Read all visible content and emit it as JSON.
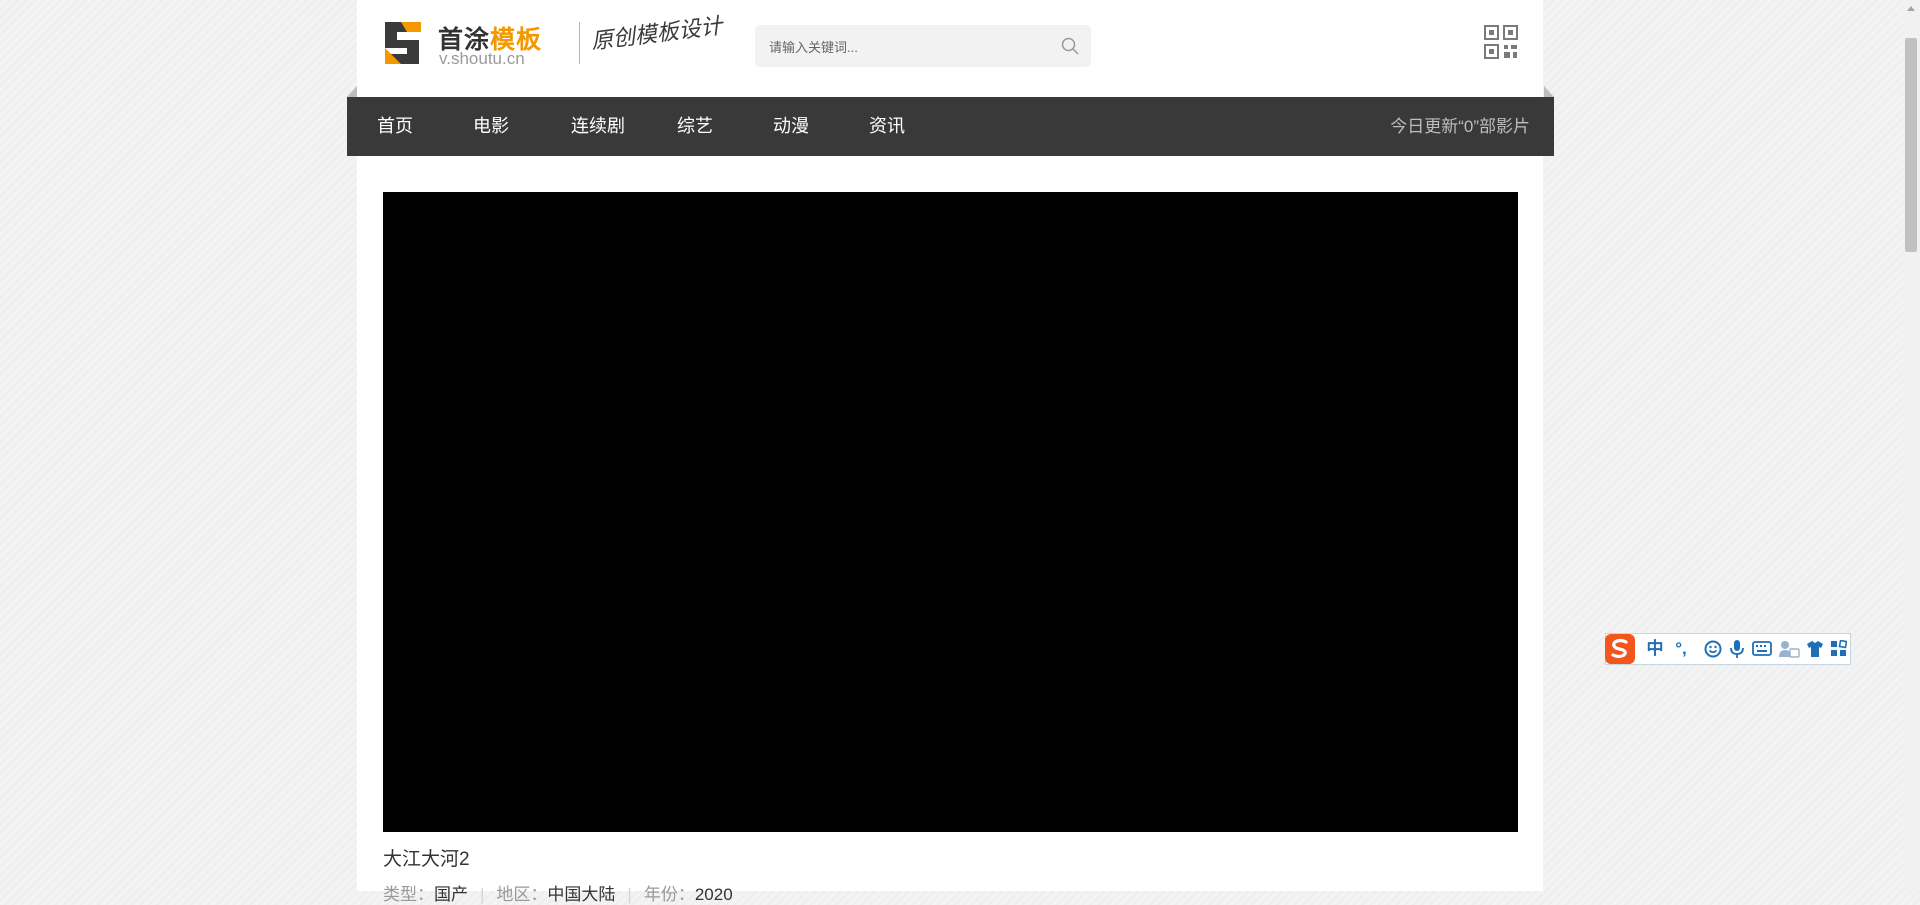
{
  "logo": {
    "title_main": "首涂",
    "title_accent": "模板",
    "url": "v.shoutu.cn",
    "slogan": "原创模板设计"
  },
  "search": {
    "placeholder": "请输入关键词..."
  },
  "nav": {
    "items": [
      {
        "label": "首页"
      },
      {
        "label": "电影"
      },
      {
        "label": "连续剧"
      },
      {
        "label": "综艺"
      },
      {
        "label": "动漫"
      },
      {
        "label": "资讯"
      }
    ],
    "status": "今日更新“0”部影片"
  },
  "video": {
    "title": "大江大河2",
    "meta": [
      {
        "label": "类型：",
        "value": "国产"
      },
      {
        "label": "地区：",
        "value": "中国大陆"
      },
      {
        "label": "年份：",
        "value": "2020"
      }
    ]
  },
  "ime": {
    "items": [
      "中",
      "°,"
    ]
  },
  "colors": {
    "nav_bg": "#393939",
    "accent": "#f39800",
    "player_bg": "#000000",
    "ime_brand": "#f2561d",
    "ime_icon": "#1f6fb8"
  }
}
